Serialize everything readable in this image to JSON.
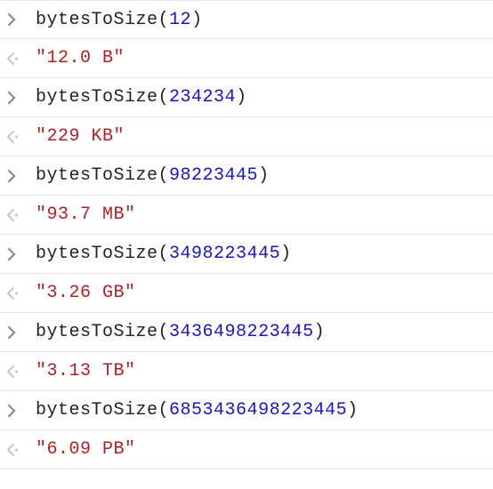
{
  "entries": [
    {
      "fn": "bytesToSize",
      "arg": "12",
      "result": "12.0 B"
    },
    {
      "fn": "bytesToSize",
      "arg": "234234",
      "result": "229 KB"
    },
    {
      "fn": "bytesToSize",
      "arg": "98223445",
      "result": "93.7 MB"
    },
    {
      "fn": "bytesToSize",
      "arg": "3498223445",
      "result": "3.26 GB"
    },
    {
      "fn": "bytesToSize",
      "arg": "3436498223445",
      "result": "3.13 TB"
    },
    {
      "fn": "bytesToSize",
      "arg": "6853436498223445",
      "result": "6.09 PB"
    }
  ]
}
